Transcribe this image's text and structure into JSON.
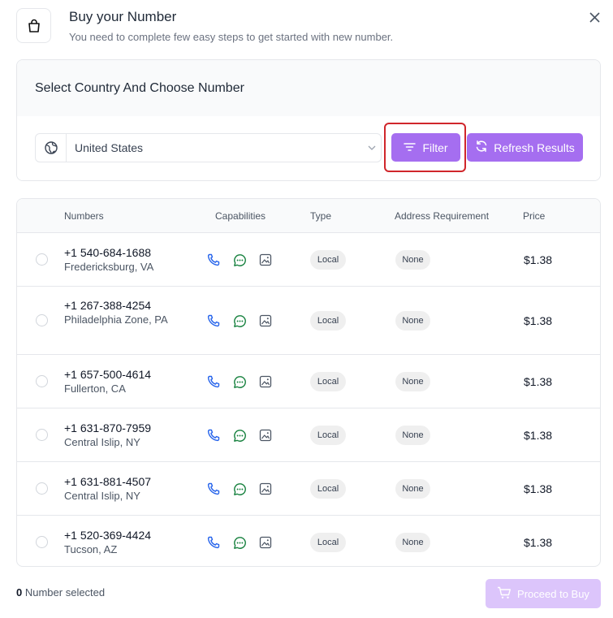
{
  "header": {
    "title": "Buy your Number",
    "subtitle": "You need to complete few easy steps to get started with new number."
  },
  "select_panel": {
    "heading": "Select Country And Choose Number",
    "country_value": "United States",
    "filter_label": "Filter",
    "refresh_label": "Refresh Results"
  },
  "table": {
    "columns": {
      "numbers": "Numbers",
      "capabilities": "Capabilities",
      "type": "Type",
      "address": "Address Requirement",
      "price": "Price"
    },
    "rows": [
      {
        "number": "+1 540-684-1688",
        "location": "Fredericksburg, VA",
        "type": "Local",
        "address": "None",
        "price": "$1.38"
      },
      {
        "number": "+1 267-388-4254",
        "location": "Philadelphia Zone, PA",
        "type": "Local",
        "address": "None",
        "price": "$1.38"
      },
      {
        "number": "+1 657-500-4614",
        "location": "Fullerton, CA",
        "type": "Local",
        "address": "None",
        "price": "$1.38"
      },
      {
        "number": "+1 631-870-7959",
        "location": "Central Islip, NY",
        "type": "Local",
        "address": "None",
        "price": "$1.38"
      },
      {
        "number": "+1 631-881-4507",
        "location": "Central Islip, NY",
        "type": "Local",
        "address": "None",
        "price": "$1.38"
      },
      {
        "number": "+1 520-369-4424",
        "location": "Tucson, AZ",
        "type": "Local",
        "address": "None",
        "price": "$1.38"
      }
    ]
  },
  "footer": {
    "selected_count": "0",
    "selected_label": "Number selected",
    "proceed_label": "Proceed to Buy"
  },
  "icons": {
    "header": "shopping-bag-icon",
    "close": "close-icon",
    "country": "globe-icon",
    "filter": "filter-lines-icon",
    "refresh": "refresh-icon",
    "capabilities": [
      "phone-icon",
      "chat-icon",
      "image-icon"
    ],
    "proceed": "cart-icon"
  },
  "colors": {
    "primary": "#a56ef0",
    "primary_disabled": "#dcc5fb",
    "phone": "#2563eb",
    "chat": "#15803d",
    "highlight": "#d0262b"
  }
}
